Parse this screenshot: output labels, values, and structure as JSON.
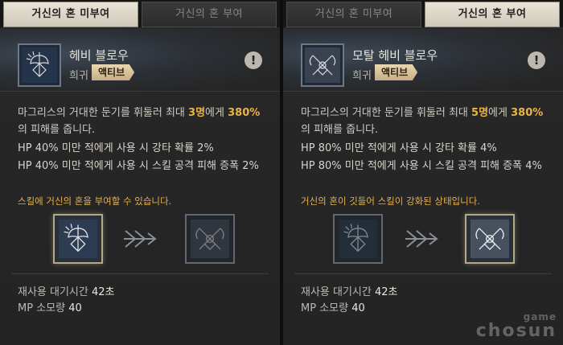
{
  "tabs": {
    "left": "거신의 혼 미부여",
    "right": "거신의 혼 부여"
  },
  "left": {
    "name": "헤비 블로우",
    "rarity": "희귀",
    "badge": "액티브",
    "desc_pre": "마그리스의 거대한 둔기를 휘둘러 최대 ",
    "desc_targets": "3명",
    "desc_mid": "에게 ",
    "desc_pct": "380%",
    "desc_post": "의 피해를 줍니다.",
    "effect1": "HP 40% 미만 적에게 사용 시 강타 확률 2%",
    "effect2": "HP 40% 미만 적에게 사용 시 스킬 공격 피해 증폭 2%",
    "notice": "스킬에 거신의 혼을 부여할 수 있습니다.",
    "cooldown_label": "재사용 대기시간",
    "cooldown_value": "42초",
    "mp_label": "MP 소모량",
    "mp_value": "40"
  },
  "right": {
    "name": "모탈 헤비 블로우",
    "rarity": "희귀",
    "badge": "액티브",
    "desc_pre": "마그리스의 거대한 둔기를 휘둘러 최대 ",
    "desc_targets": "5명",
    "desc_mid": "에게 ",
    "desc_pct": "380%",
    "desc_post": "의 피해를 줍니다.",
    "effect1": "HP 80% 미만 적에게 사용 시 강타 확률 4%",
    "effect2": "HP 80% 미만 적에게 사용 시 스킬 공격 피해 증폭 4%",
    "notice": "거신의 혼이 깃들어 스킬이 강화된 상태입니다.",
    "cooldown_label": "재사용 대기시간",
    "cooldown_value": "42초",
    "mp_label": "MP 소모량",
    "mp_value": "40"
  },
  "alert_glyph": "!",
  "watermark": {
    "top": "game",
    "bottom": "chosun"
  },
  "colors": {
    "highlight": "#e8b34a",
    "notice": "#e6b04a",
    "active_tab": "#e9e4d8"
  }
}
